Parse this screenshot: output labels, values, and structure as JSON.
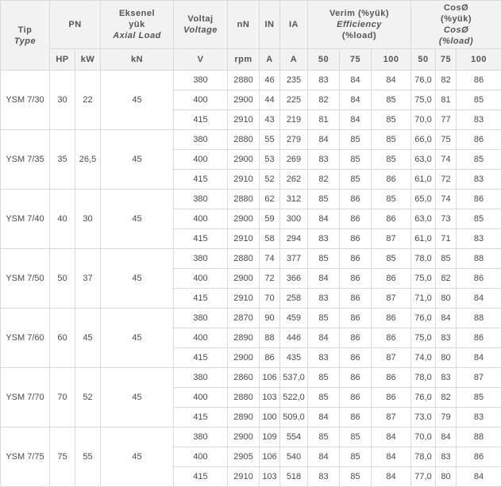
{
  "headers": {
    "tip": "Tip",
    "type": "Type",
    "pn": "PN",
    "eksenel_1": "Eksenel",
    "eksenel_2": "yük",
    "axial_load": "Axial Load",
    "voltaj": "Voltaj",
    "voltage": "Voltage",
    "nN": "nN",
    "IN": "IN",
    "IA": "IA",
    "verim": "Verim (%yük)",
    "efficiency": "Efficiency",
    "load_pct": "(%load)",
    "cos": "CosØ",
    "cos_yuk": "(%yük)",
    "cos_2": "CosØ",
    "cos_load": "(%load)"
  },
  "units": {
    "hp": "HP",
    "kw": "kW",
    "kn": "kN",
    "v": "V",
    "rpm": "rpm",
    "a_in": "A",
    "a_ia": "A",
    "eff50": "50",
    "eff75": "75",
    "eff100": "100",
    "cos50": "50",
    "cos75": "75",
    "cos100": "100"
  },
  "groups": [
    {
      "type": "YSM 7/30",
      "hp": "30",
      "kw": "22",
      "kn": "45",
      "rows": [
        [
          "380",
          "2880",
          "46",
          "235",
          "83",
          "84",
          "84",
          "76,0",
          "82",
          "86"
        ],
        [
          "400",
          "2900",
          "44",
          "225",
          "82",
          "84",
          "85",
          "75,0",
          "81",
          "85"
        ],
        [
          "415",
          "2910",
          "43",
          "219",
          "81",
          "84",
          "85",
          "70,0",
          "77",
          "83"
        ]
      ]
    },
    {
      "type": "YSM 7/35",
      "hp": "35",
      "kw": "26,5",
      "kn": "45",
      "rows": [
        [
          "380",
          "2880",
          "55",
          "279",
          "84",
          "85",
          "85",
          "66,0",
          "75",
          "86"
        ],
        [
          "400",
          "2900",
          "53",
          "269",
          "83",
          "85",
          "85",
          "63,0",
          "74",
          "85"
        ],
        [
          "415",
          "2910",
          "52",
          "262",
          "82",
          "85",
          "86",
          "61,0",
          "72",
          "83"
        ]
      ]
    },
    {
      "type": "YSM 7/40",
      "hp": "40",
      "kw": "30",
      "kn": "45",
      "rows": [
        [
          "380",
          "2880",
          "62",
          "312",
          "85",
          "86",
          "85",
          "65,0",
          "74",
          "86"
        ],
        [
          "400",
          "2900",
          "59",
          "300",
          "84",
          "86",
          "86",
          "63,0",
          "73",
          "85"
        ],
        [
          "415",
          "2910",
          "58",
          "294",
          "83",
          "86",
          "87",
          "61,0",
          "71",
          "83"
        ]
      ]
    },
    {
      "type": "YSM 7/50",
      "hp": "50",
      "kw": "37",
      "kn": "45",
      "rows": [
        [
          "380",
          "2880",
          "74",
          "377",
          "85",
          "86",
          "85",
          "78,0",
          "85",
          "88"
        ],
        [
          "400",
          "2900",
          "72",
          "366",
          "84",
          "86",
          "86",
          "75,0",
          "82",
          "86"
        ],
        [
          "415",
          "2910",
          "70",
          "258",
          "83",
          "86",
          "87",
          "71,0",
          "80",
          "84"
        ]
      ]
    },
    {
      "type": "YSM 7/60",
      "hp": "60",
      "kw": "45",
      "kn": "45",
      "rows": [
        [
          "380",
          "2870",
          "90",
          "459",
          "85",
          "86",
          "86",
          "76,0",
          "84",
          "88"
        ],
        [
          "400",
          "2890",
          "88",
          "446",
          "84",
          "86",
          "86",
          "75,0",
          "83",
          "86"
        ],
        [
          "415",
          "2900",
          "86",
          "435",
          "83",
          "86",
          "87",
          "74,0",
          "80",
          "84"
        ]
      ]
    },
    {
      "type": "YSM 7/70",
      "hp": "70",
      "kw": "52",
      "kn": "45",
      "rows": [
        [
          "380",
          "2860",
          "106",
          "537,0",
          "85",
          "86",
          "86",
          "78,0",
          "83",
          "87"
        ],
        [
          "400",
          "2880",
          "103",
          "522,0",
          "85",
          "86",
          "86",
          "76,0",
          "82",
          "85"
        ],
        [
          "415",
          "2890",
          "100",
          "509,0",
          "84",
          "86",
          "87",
          "73,0",
          "79",
          "83"
        ]
      ]
    },
    {
      "type": "YSM 7/75",
      "hp": "75",
      "kw": "55",
      "kn": "45",
      "rows": [
        [
          "380",
          "2900",
          "109",
          "554",
          "85",
          "85",
          "84",
          "70,0",
          "84",
          "88"
        ],
        [
          "400",
          "2905",
          "106",
          "540",
          "84",
          "85",
          "84",
          "78,0",
          "83",
          "86"
        ],
        [
          "415",
          "2910",
          "103",
          "518",
          "83",
          "85",
          "84",
          "77,0",
          "80",
          "84"
        ]
      ]
    }
  ]
}
